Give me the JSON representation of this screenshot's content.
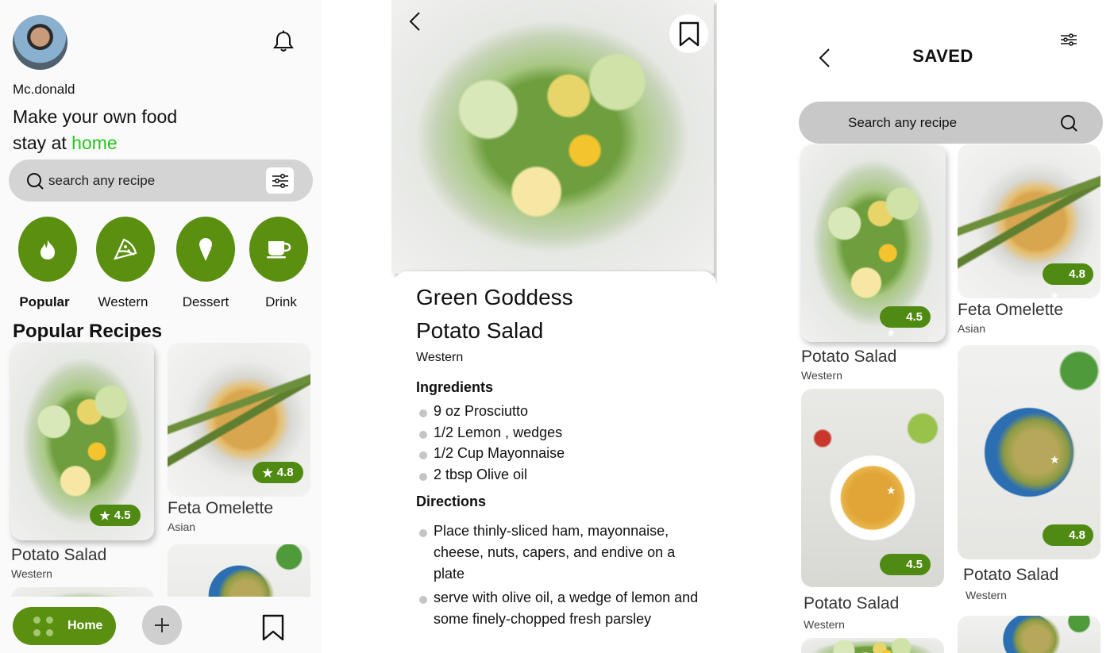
{
  "home": {
    "username": "Mc.donald",
    "headline_line1": "Make your own food",
    "headline_line2_prefix": "stay at ",
    "headline_highlight": "home",
    "search_placeholder": "search any recipe",
    "categories": [
      {
        "label": "Popular",
        "icon": "fire-icon"
      },
      {
        "label": "Western",
        "icon": "pizza-icon"
      },
      {
        "label": "Dessert",
        "icon": "ice-cream-icon"
      },
      {
        "label": "Drink",
        "icon": "coffee-cup-icon"
      }
    ],
    "section_title": "Popular Recipes",
    "recipes": [
      {
        "title": "Potato Salad",
        "category": "Western",
        "rating": "4.5"
      },
      {
        "title": "Feta Omelette",
        "category": "Asian",
        "rating": "4.8"
      }
    ],
    "nav": {
      "home_label": "Home"
    }
  },
  "detail": {
    "title_line1": "Green Goddess",
    "title_line2": "Potato Salad",
    "category": "Western",
    "ingredients_heading": "Ingredients",
    "ingredients": [
      "9 oz Prosciutto",
      "1/2 Lemon , wedges",
      "1/2 Cup Mayonnaise",
      "2 tbsp Olive oil"
    ],
    "directions_heading": "Directions",
    "directions": [
      "Place thinly-sliced ham, mayonnaise, cheese, nuts, capers, and endive on a plate",
      "serve with olive oil, a wedge of lemon and some finely-chopped fresh parsley"
    ]
  },
  "saved": {
    "title": "SAVED",
    "search_placeholder": "Search any recipe",
    "items": [
      {
        "title": "Potato Salad",
        "category": "Western",
        "rating": "4.5"
      },
      {
        "title": "Feta Omelette",
        "category": "Asian",
        "rating": "4.8"
      },
      {
        "title": "Potato Salad",
        "category": "Western",
        "rating": "4.5"
      },
      {
        "title": "Potato Salad",
        "category": "Western",
        "rating": "4.8"
      }
    ]
  },
  "colors": {
    "accent_green": "#5b8f0f",
    "highlight_green": "#27c51e",
    "rating_green": "#4f8a12"
  }
}
